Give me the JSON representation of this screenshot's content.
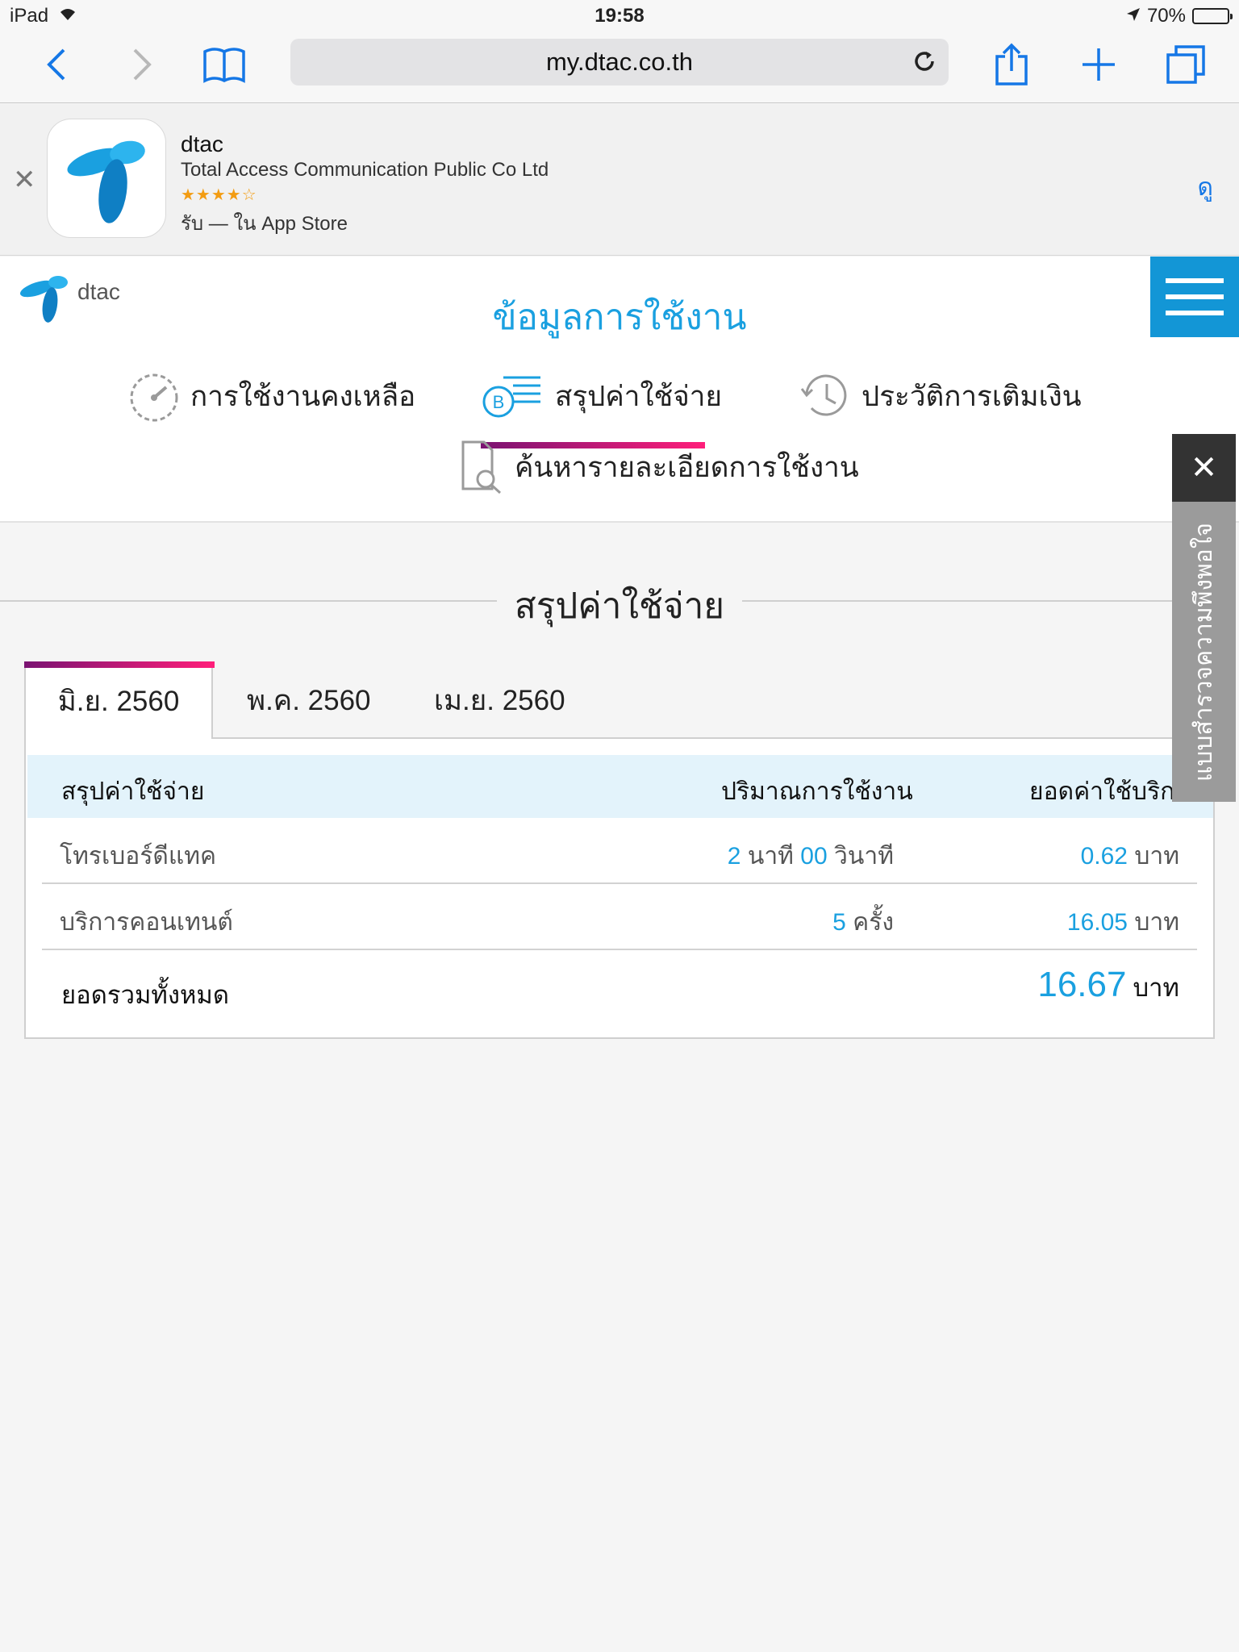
{
  "status_bar": {
    "device": "iPad",
    "time": "19:58",
    "battery": "70%"
  },
  "browser": {
    "url": "my.dtac.co.th"
  },
  "app_banner": {
    "app_name": "dtac",
    "company": "Total Access Communication Public Co Ltd",
    "rating_stars": "★★★★☆",
    "get_text": "รับ — ใน App Store",
    "view_label": "ดู"
  },
  "site": {
    "logo_text": "dtac",
    "heading": "ข้อมูลการใช้งาน",
    "accent": "#1aa0e0",
    "nav": [
      {
        "label": "การใช้งานคงเหลือ",
        "icon": "speedometer-icon"
      },
      {
        "label": "สรุปค่าใช้จ่าย",
        "icon": "bill-coin-icon"
      },
      {
        "label": "ประวัติการเติมเงิน",
        "icon": "history-clock-icon"
      },
      {
        "label": "ค้นหารายละเอียดการใช้งาน",
        "icon": "document-search-icon"
      }
    ]
  },
  "summary": {
    "title": "สรุปค่าใช้จ่าย",
    "tabs": [
      "มิ.ย. 2560",
      "พ.ค. 2560",
      "เม.ย. 2560"
    ],
    "table": {
      "headers": [
        "สรุปค่าใช้จ่าย",
        "ปริมาณการใช้งาน",
        "ยอดค่าใช้บริการ"
      ],
      "rows": [
        {
          "name": "โทรเบอร์ดีแทค",
          "usage": {
            "a": "2",
            "a_unit": "นาที",
            "b": "00",
            "b_unit": "วินาที"
          },
          "cost": "0.62",
          "cost_unit": "บาท"
        },
        {
          "name": "บริการคอนเทนต์",
          "usage": {
            "a": "5",
            "a_unit": "ครั้ง"
          },
          "cost": "16.05",
          "cost_unit": "บาท"
        }
      ],
      "total_label": "ยอดรวมทั้งหมด",
      "total": "16.67",
      "total_unit": "บาท"
    }
  },
  "feedback": {
    "close": "✕",
    "label": "แบบสำรวจความพึงพอใจ"
  }
}
